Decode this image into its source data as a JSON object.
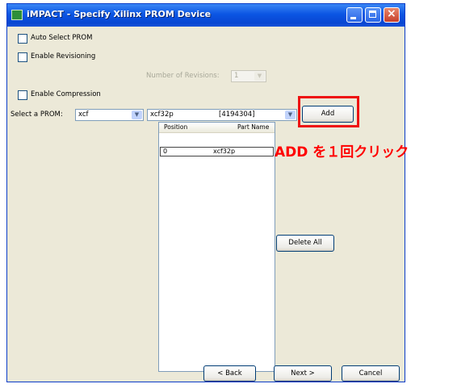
{
  "window": {
    "title": "iMPACT - Specify Xilinx PROM Device"
  },
  "options": {
    "auto_select_prom": {
      "label": "Auto Select PROM",
      "checked": false
    },
    "enable_revisioning": {
      "label": "Enable Revisioning",
      "checked": false
    },
    "number_of_revisions": {
      "label": "Number of Revisions:",
      "value": "1"
    },
    "enable_compression": {
      "label": "Enable Compression",
      "checked": false
    }
  },
  "prom_select": {
    "label": "Select a PROM:",
    "family": "xcf",
    "device": "xcf32p",
    "size": "[4194304]",
    "add_label": "Add"
  },
  "prom_list": {
    "columns": [
      "Position",
      "Part Name"
    ],
    "rows": [
      {
        "position": "0",
        "part_name": "xcf32p"
      }
    ]
  },
  "buttons": {
    "delete_all": "Delete All",
    "back": "< Back",
    "next": "Next >",
    "cancel": "Cancel"
  },
  "annotation": {
    "text": "ADD を１回クリック",
    "color": "#ff0000"
  }
}
